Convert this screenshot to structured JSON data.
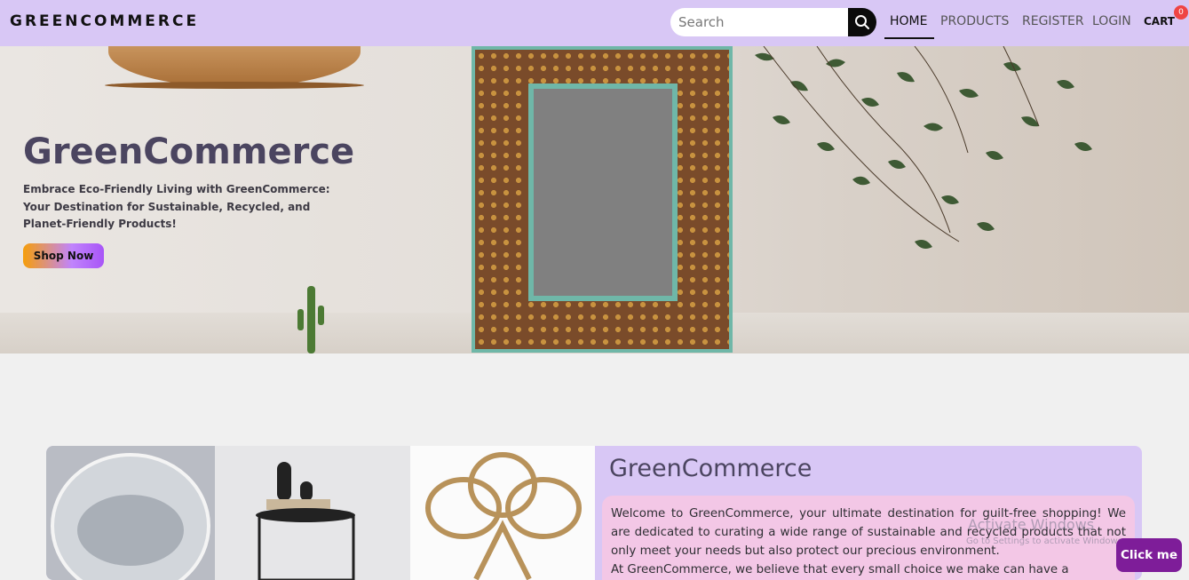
{
  "navbar": {
    "brand": "GREENCOMMERCE",
    "search_placeholder": "Search",
    "links": [
      "HOME",
      "PRODUCTS",
      "REGISTER",
      "LOGIN"
    ],
    "cart_label": "CART",
    "cart_count": "0"
  },
  "hero": {
    "title": "GreenCommerce",
    "subtitle": "Embrace Eco-Friendly Living with GreenCommerce: Your Destination for Sustainable, Recycled, and Planet-Friendly Products!",
    "cta_label": "Shop Now"
  },
  "about": {
    "title": "GreenCommerce",
    "paragraph1": "Welcome to GreenCommerce, your ultimate destination for guilt-free shopping! We are dedicated to curating a wide range of sustainable and recycled products that not only meet your needs but also protect our precious environment.",
    "paragraph2": "At GreenCommerce, we believe that every small choice we make can have a"
  },
  "watermark": {
    "title": "Activate Windows",
    "subtitle": "Go to Settings to activate Windows."
  },
  "floating_button": "Click me",
  "colors": {
    "navbar_bg": "#d8c7f5",
    "about_bg": "#d8c7f5",
    "about_text_bg": "#f3c7e6",
    "click_me_bg": "#7e1d99",
    "cart_badge": "#ef4444"
  }
}
